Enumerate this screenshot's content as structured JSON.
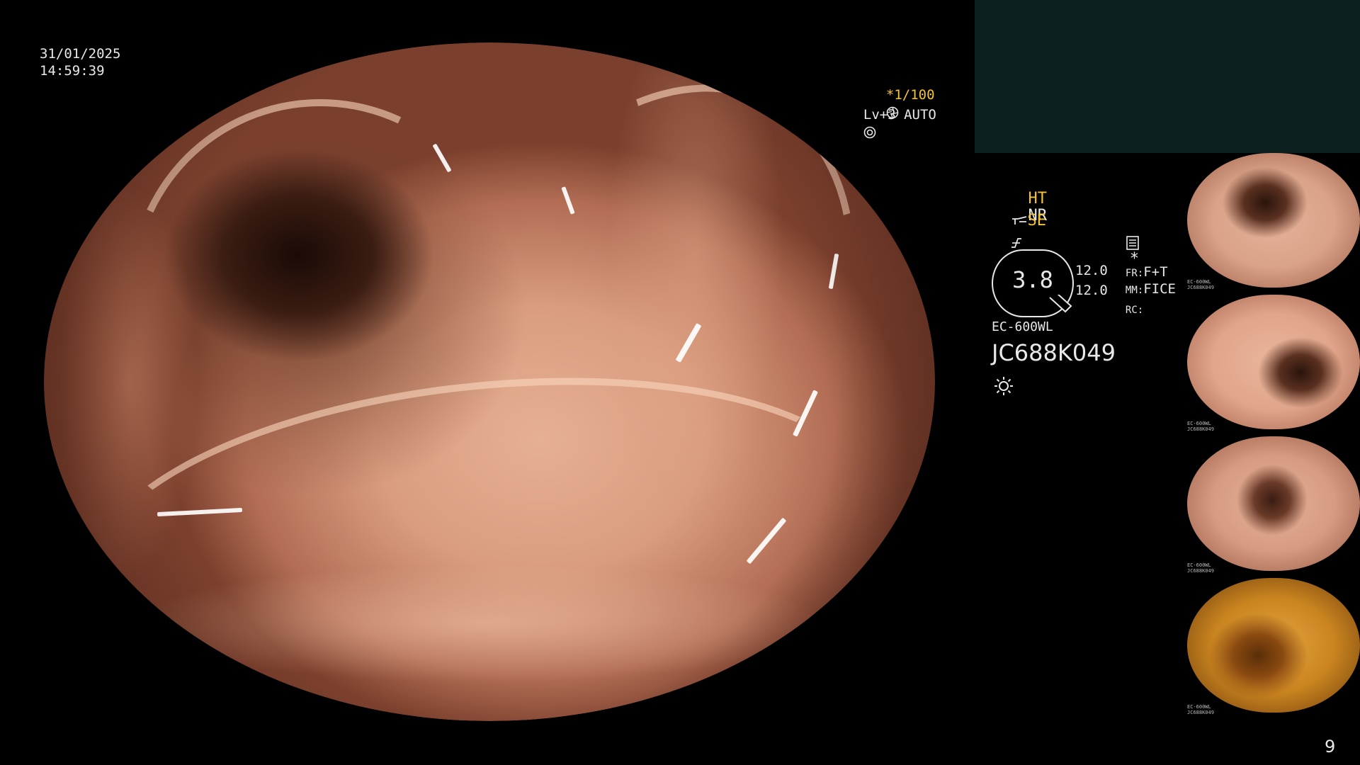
{
  "osd": {
    "date": "31/01/2025",
    "time": "14:59:39",
    "shutter": "*1/100",
    "level": "Lv+3 AUTO",
    "ht": "HT",
    "nr": "NR",
    "se": "SE",
    "zoom_value": "3.8",
    "val_a": "12.0",
    "val_b": "12.0",
    "fr_label": "FR:",
    "fr_value": "F+T",
    "mm_label": "MM:",
    "mm_value": "FICE",
    "rc_label": "RC:",
    "scope_model": "EC-600WL",
    "serial": "JC688K049",
    "asterisk": "*",
    "page_number": "9"
  },
  "thumbnails": [
    {
      "caption": "EC-600WL\nJC688K049",
      "tone": "#d9a289"
    },
    {
      "caption": "EC-600WL\nJC688K049",
      "tone": "#e0a58a"
    },
    {
      "caption": "EC-600WL\nJC688K049",
      "tone": "#d69b82"
    },
    {
      "caption": "EC-600WL\nJC688K049",
      "tone": "#c98420"
    }
  ],
  "colors": {
    "osd_text": "#e8e8e8",
    "highlight": "#f2c335",
    "panel": "#0c2020",
    "mucosa": "#d99c7e"
  },
  "icons": [
    "aperture-icon",
    "iris-icon",
    "structure-enhance-icon",
    "contrast-icon",
    "image-settings-icon",
    "light-source-icon"
  ]
}
